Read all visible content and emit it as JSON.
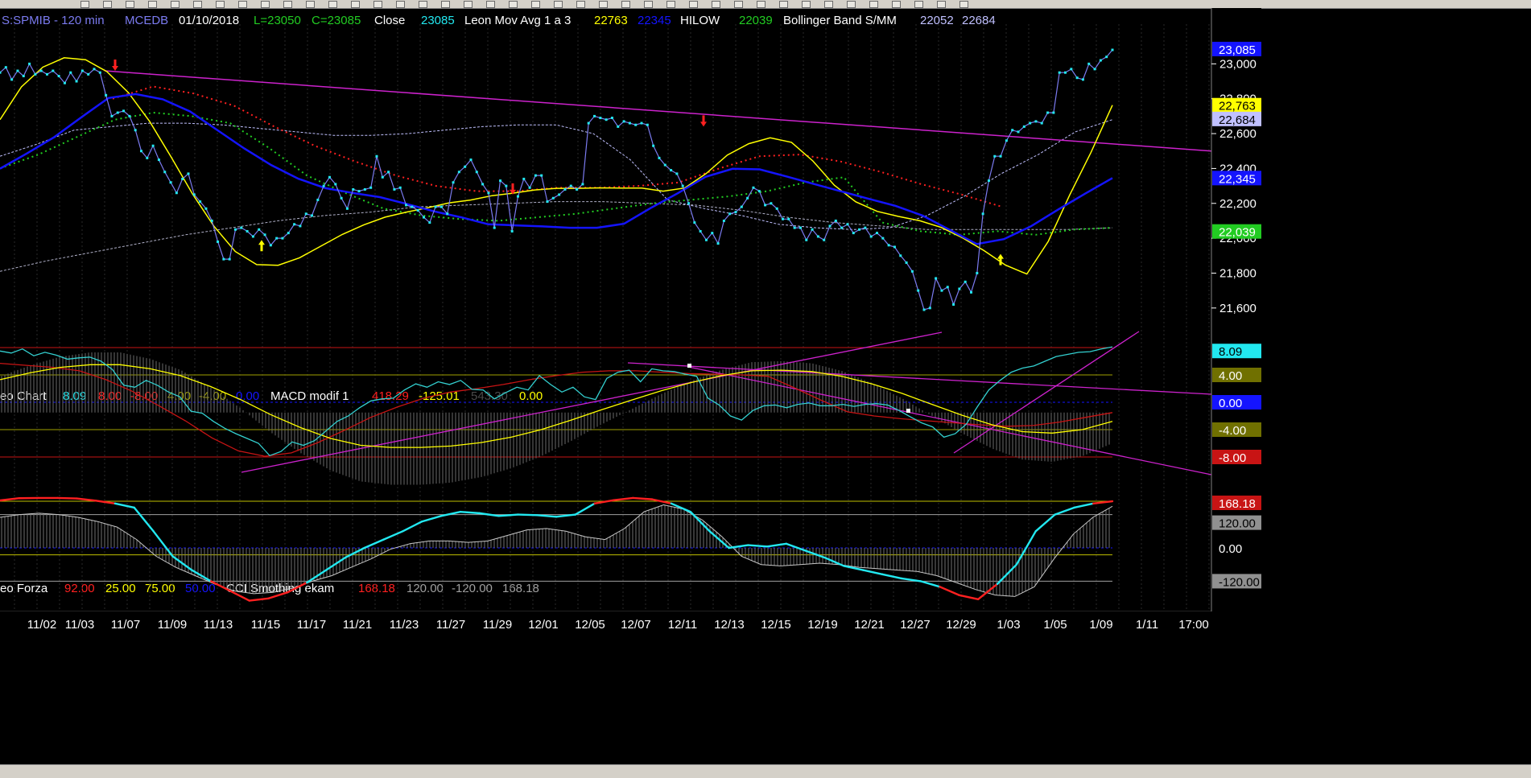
{
  "colors": {
    "background": "#000000",
    "price_line": "#7b7bf0",
    "price_markers": "#22e8f0",
    "mov_avg": "#ffff00",
    "leon_mov_avg_2": "#1414ff",
    "hilow": "#ff2020",
    "bollinger": "#22cc22",
    "bollinger_mid": "#c0c0ff",
    "trend": "#cc22cc",
    "cci": "#22e8f0",
    "cci_neg": "#ff2020",
    "gray_hist": "#a0a0a0",
    "leon_chart_line": "#33d0d0",
    "macd_red": "#c81414",
    "macd_yellow": "#ffff00"
  },
  "header": {
    "symbol": "S:SPMIB - 120 min",
    "source": "MCEDB",
    "date": "01/10/2018",
    "low": "L=23050",
    "close_eq": "C=23085",
    "close_label": "Close",
    "close_value": "23085",
    "mov_avg_label": "Leon Mov Avg 1 a 3",
    "mov_avg_v1": "22763",
    "mov_avg_v2": "22345",
    "hilow_label": "HILOW",
    "hilow_value": "22039",
    "bollinger_label": "Bollinger Band S/MM",
    "bollinger_v1": "22052",
    "bollinger_v2": "22684"
  },
  "pane2_header": {
    "name": "eo Chart",
    "v1": "8.09",
    "v2": "8.00",
    "v3": "-8.00",
    "v4": "4.00",
    "v5": "-4.00",
    "v6": "0.00",
    "macd_label": "MACD modif 1",
    "macd_v1": "418.29",
    "macd_v2": "-125.01",
    "macd_v3": "543.30",
    "macd_v4": "0.00"
  },
  "pane3_header": {
    "name": "eo Forza",
    "v1": "92.00",
    "v2": "25.00",
    "v3": "75.00",
    "v4": "50.00",
    "cci_label": "CCI Smothing ekam",
    "cci_v1": "168.18",
    "cci_v2": "120.00",
    "cci_v3": "-120.00",
    "cci_v4": "168.18"
  },
  "chart_data": [
    {
      "type": "line",
      "pane": "price",
      "y_ticks": [
        "23,000",
        "22,800",
        "22,600",
        "22,400",
        "22,200",
        "22,000",
        "21,800",
        "21,600"
      ],
      "ylim": [
        21530,
        23200
      ],
      "value_boxes": [
        "23,085",
        "22,763",
        "22,684",
        "22,345",
        "22,039"
      ],
      "x_tick_labels": [
        "11/02",
        "11/03",
        "11/07",
        "11/09",
        "11/13",
        "11/15",
        "11/17",
        "11/21",
        "11/23",
        "11/27",
        "11/29",
        "12/01",
        "12/05",
        "12/07",
        "12/11",
        "12/13",
        "12/15",
        "12/19",
        "12/21",
        "12/27",
        "12/29",
        "1/03",
        "1/05",
        "1/09",
        "1/11",
        "17:00"
      ],
      "series": [
        {
          "key": "price",
          "values": [
            22950,
            22980,
            22910,
            22960,
            22930,
            23000,
            22940,
            22960,
            22940,
            22960,
            22930,
            22890,
            22950,
            22900,
            22960,
            22940,
            22970,
            22950,
            22820,
            22700,
            22720,
            22730,
            22700,
            22620,
            22500,
            22460,
            22530,
            22450,
            22380,
            22320,
            22260,
            22340,
            22370,
            22250,
            22210,
            22170,
            22100,
            21980,
            21880,
            21880,
            22050,
            22060,
            22040,
            22010,
            22050,
            22020,
            21960,
            22000,
            22000,
            22030,
            22080,
            22070,
            22140,
            22130,
            22220,
            22300,
            22350,
            22310,
            22230,
            22170,
            22280,
            22270,
            22280,
            22290,
            22470,
            22350,
            22380,
            22280,
            22290,
            22190,
            22180,
            22160,
            22120,
            22090,
            22180,
            22180,
            22140,
            22320,
            22380,
            22410,
            22450,
            22380,
            22310,
            22260,
            22060,
            22330,
            22300,
            22040,
            22240,
            22340,
            22290,
            22360,
            22360,
            22210,
            22230,
            22250,
            22280,
            22300,
            22280,
            22310,
            22660,
            22700,
            22690,
            22680,
            22690,
            22640,
            22670,
            22660,
            22650,
            22660,
            22650,
            22530,
            22460,
            22420,
            22390,
            22370,
            22300,
            22200,
            22090,
            22040,
            21990,
            22030,
            21970,
            22100,
            22140,
            22150,
            22180,
            22230,
            22290,
            22270,
            22190,
            22200,
            22170,
            22110,
            22110,
            22060,
            22060,
            21990,
            22050,
            22010,
            21990,
            22070,
            22100,
            22060,
            22080,
            22030,
            22050,
            22060,
            22010,
            22030,
            22000,
            21960,
            21950,
            21900,
            21860,
            21810,
            21700,
            21590,
            21600,
            21770,
            21700,
            21720,
            21620,
            21710,
            21750,
            21690,
            21800,
            22140,
            22330,
            22470,
            22470,
            22560,
            22620,
            22610,
            22640,
            22660,
            22670,
            22660,
            22720,
            22720,
            22950,
            22950,
            22970,
            22920,
            22910,
            23000,
            22970,
            23020,
            23040,
            23080
          ]
        },
        {
          "key": "mov_avg",
          "values": [
            22680,
            22868,
            22981,
            23035,
            23024,
            22955,
            22835,
            22669,
            22466,
            22254,
            22069,
            21924,
            21849,
            21845,
            21888,
            21955,
            22022,
            22076,
            22121,
            22150,
            22175,
            22203,
            22219,
            22244,
            22259,
            22277,
            22286,
            22286,
            22289,
            22288,
            22288,
            22270,
            22288,
            22370,
            22477,
            22542,
            22576,
            22550,
            22443,
            22304,
            22209,
            22154,
            22125,
            22100,
            22062,
            22002,
            21929,
            21846,
            21795,
            21982,
            22247,
            22493,
            22763
          ]
        },
        {
          "key": "mov_avg_2",
          "values": [
            22399,
            22487,
            22580,
            22694,
            22804,
            22827,
            22797,
            22727,
            22621,
            22515,
            22419,
            22341,
            22287,
            22260,
            22236,
            22196,
            22154,
            22120,
            22080,
            22074,
            22068,
            22060,
            22060,
            22083,
            22175,
            22260,
            22352,
            22398,
            22395,
            22354,
            22311,
            22269,
            22227,
            22186,
            22130,
            22048,
            21967,
            21995,
            22069,
            22165,
            22256,
            22345
          ]
        },
        {
          "key": "hilow",
          "values": [
            22800,
            22870,
            22830,
            22760,
            22640,
            22530,
            22440,
            22360,
            22300,
            22270,
            22270,
            22290,
            22290,
            22300,
            22320,
            22400,
            22470,
            22480,
            22440,
            22380,
            22310,
            22250,
            22180
          ]
        },
        {
          "key": "bollinger_low",
          "values": [
            22400,
            22480,
            22580,
            22680,
            22720,
            22700,
            22660,
            22520,
            22360,
            22260,
            22170,
            22130,
            22110,
            22100,
            22120,
            22140,
            22170,
            22200,
            22220,
            22240,
            22270,
            22320,
            22350,
            22090,
            22040,
            22020,
            22040,
            22020,
            22050,
            22060
          ]
        },
        {
          "key": "bollinger_mid",
          "values": [
            22470,
            22540,
            22620,
            22640,
            22660,
            22660,
            22650,
            22630,
            22610,
            22590,
            22590,
            22600,
            22620,
            22640,
            22650,
            22650,
            22600,
            22450,
            22220,
            22170,
            22130,
            22080,
            22060,
            22050,
            22060,
            22130,
            22240,
            22370,
            22480,
            22610,
            22680
          ]
        },
        {
          "key": "bollinger_band",
          "values": [
            21810,
            21870,
            21920,
            21970,
            22020,
            22060,
            22100,
            22130,
            22150,
            22180,
            22190,
            22200,
            22210,
            22210,
            22200,
            22190,
            22160,
            22120,
            22090,
            22070,
            22050,
            22050,
            22050,
            22050,
            22060
          ]
        },
        {
          "key": "trend_price",
          "values": [
            22960,
            22500
          ]
        }
      ]
    },
    {
      "type": "line",
      "pane": "oscillator",
      "levels": [
        "8.09",
        "4.00",
        "0.00",
        "-4.00",
        "-8.00"
      ],
      "ylim": [
        -10,
        10
      ],
      "series": [
        {
          "key": "osc",
          "values": [
            7.5,
            7.2,
            7.8,
            6.8,
            7.3,
            6.9,
            6.3,
            6.5,
            6.6,
            6.0,
            4.8,
            2.5,
            2.2,
            3.2,
            2.5,
            1.5,
            0.8,
            -1.3,
            -1.6,
            -2.8,
            -3.8,
            -4.6,
            -5.3,
            -6.0,
            -7.8,
            -7.2,
            -5.8,
            -6.3,
            -5.6,
            -4.2,
            -2.8,
            -2.0,
            -0.8,
            0.2,
            0.5,
            0.6,
            1.8,
            2.7,
            2.2,
            3.0,
            2.6,
            3.2,
            1.9,
            1.8,
            0.5,
            1.4,
            2.2,
            1.8,
            3.9,
            2.6,
            1.5,
            2.2,
            0.8,
            0.4,
            3.5,
            4.4,
            4.7,
            3.0,
            4.9,
            4.6,
            4.5,
            4.1,
            3.8,
            0.6,
            -0.4,
            -2.0,
            -2.6,
            -1.2,
            -0.5,
            -0.4,
            -0.8,
            -0.3,
            -0.1,
            -0.5,
            -0.5,
            -0.3,
            -0.6,
            -0.3,
            -0.2,
            -0.4,
            -1.2,
            -2.1,
            -3.0,
            -3.6,
            -5.1,
            -4.6,
            -3.2,
            -0.6,
            1.8,
            3.2,
            4.4,
            5.0,
            5.3,
            6.0,
            6.7,
            7.0,
            7.3,
            7.4,
            7.8,
            8.1
          ]
        },
        {
          "key": "macd_red",
          "values": [
            5.7,
            5.4,
            5.1,
            4.6,
            3.3,
            1.6,
            -0.5,
            -2.7,
            -5.2,
            -7.1,
            -7.9,
            -7.4,
            -5.9,
            -4.1,
            -2.2,
            -0.7,
            0.6,
            1.5,
            2.0,
            2.6,
            3.3,
            3.9,
            4.4,
            4.6,
            4.6,
            4.4,
            4.2,
            4.1,
            4.0,
            3.8,
            2.1,
            0.3,
            -1.4,
            -2.0,
            -2.4,
            -2.7,
            -3.0,
            -3.3,
            -3.5,
            -3.4,
            -2.9,
            -2.2,
            -1.5
          ]
        },
        {
          "key": "macd_yellow",
          "values": [
            3.3,
            4.3,
            5.1,
            5.5,
            5.5,
            4.9,
            3.9,
            2.3,
            0.4,
            -1.8,
            -3.7,
            -5.3,
            -6.3,
            -6.6,
            -6.6,
            -6.4,
            -5.9,
            -5.1,
            -4.0,
            -2.6,
            -1.1,
            0.3,
            1.7,
            2.9,
            3.9,
            4.6,
            4.7,
            4.5,
            3.8,
            2.7,
            1.3,
            -0.3,
            -1.9,
            -3.3,
            -4.3,
            -4.5,
            -4.0,
            -2.8
          ]
        }
      ]
    },
    {
      "type": "line",
      "pane": "cci",
      "levels": [
        "168.18",
        "120.00",
        "0.00",
        "-120.00"
      ],
      "ylim": [
        -200,
        200
      ],
      "series": [
        {
          "key": "cci",
          "values": [
            171,
            179,
            180,
            180,
            178,
            170,
            160,
            145,
            60,
            -30,
            -80,
            -120,
            -155,
            -190,
            -182,
            -160,
            -125,
            -80,
            -35,
            0,
            30,
            60,
            95,
            115,
            130,
            125,
            115,
            120,
            118,
            112,
            120,
            160,
            172,
            180,
            175,
            160,
            130,
            60,
            0,
            10,
            5,
            15,
            -10,
            -35,
            -65,
            -80,
            -95,
            -110,
            -120,
            -140,
            -170,
            -185,
            -130,
            -60,
            60,
            120,
            145,
            160,
            168
          ]
        },
        {
          "key": "cci_gray",
          "values": [
            110,
            120,
            125,
            120,
            110,
            95,
            75,
            30,
            -30,
            -70,
            -100,
            -130,
            -155,
            -165,
            -160,
            -145,
            -120,
            -100,
            -70,
            -40,
            -5,
            15,
            25,
            25,
            20,
            25,
            45,
            65,
            70,
            60,
            40,
            30,
            70,
            130,
            155,
            140,
            100,
            40,
            -30,
            -60,
            -65,
            -60,
            -55,
            -60,
            -70,
            -75,
            -80,
            -85,
            -100,
            -125,
            -150,
            -170,
            -175,
            -140,
            -40,
            50,
            110,
            150
          ]
        }
      ]
    }
  ]
}
